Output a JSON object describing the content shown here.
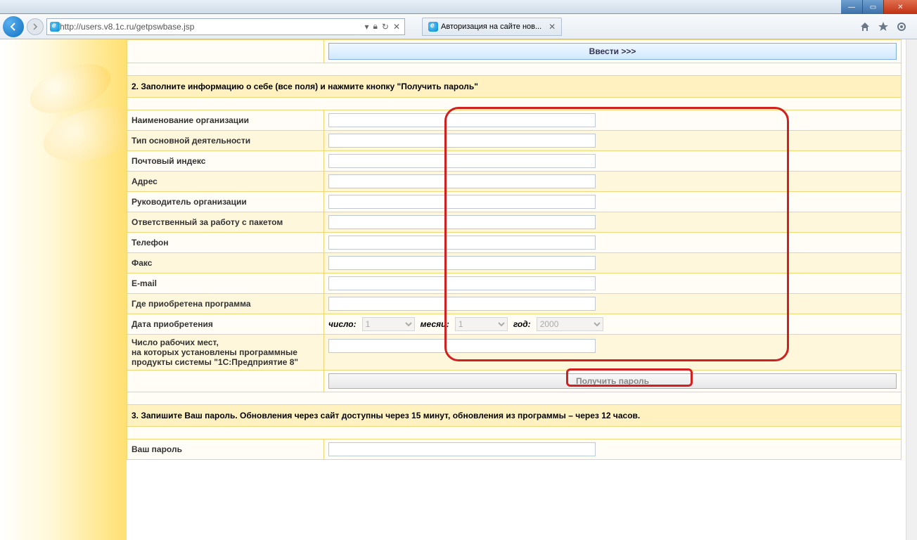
{
  "browser": {
    "url": "http://users.v8.1c.ru/getpswbase.jsp",
    "tab_title": "Авторизация на сайте нов..."
  },
  "buttons": {
    "enter": "Ввести >>>",
    "submit": "Получить пароль"
  },
  "sections": {
    "s2": "2. Заполните информацию о себе (все поля) и нажмите кнопку \"Получить пароль\"",
    "s3": "3. Запишите Ваш пароль. Обновления через сайт доступны через 15 минут, обновления из программы – через 12 часов."
  },
  "labels": {
    "org_name": "Наименование организации",
    "activity": "Тип основной деятельности",
    "zip": "Почтовый индекс",
    "address": "Адрес",
    "head": "Руководитель организации",
    "responsible": "Ответственный за работу с пакетом",
    "phone": "Телефон",
    "fax": "Факс",
    "email": "E-mail",
    "purchased_where": "Где приобретена программа",
    "purchase_date": "Дата приобретения",
    "seats": "Число рабочих мест,\nна которых установлены программные продукты системы \"1С:Предприятие 8\"",
    "your_password": "Ваш пароль"
  },
  "date": {
    "day_label": "число:",
    "month_label": "месяц:",
    "year_label": "год:",
    "day": "1",
    "month": "1",
    "year": "2000"
  }
}
